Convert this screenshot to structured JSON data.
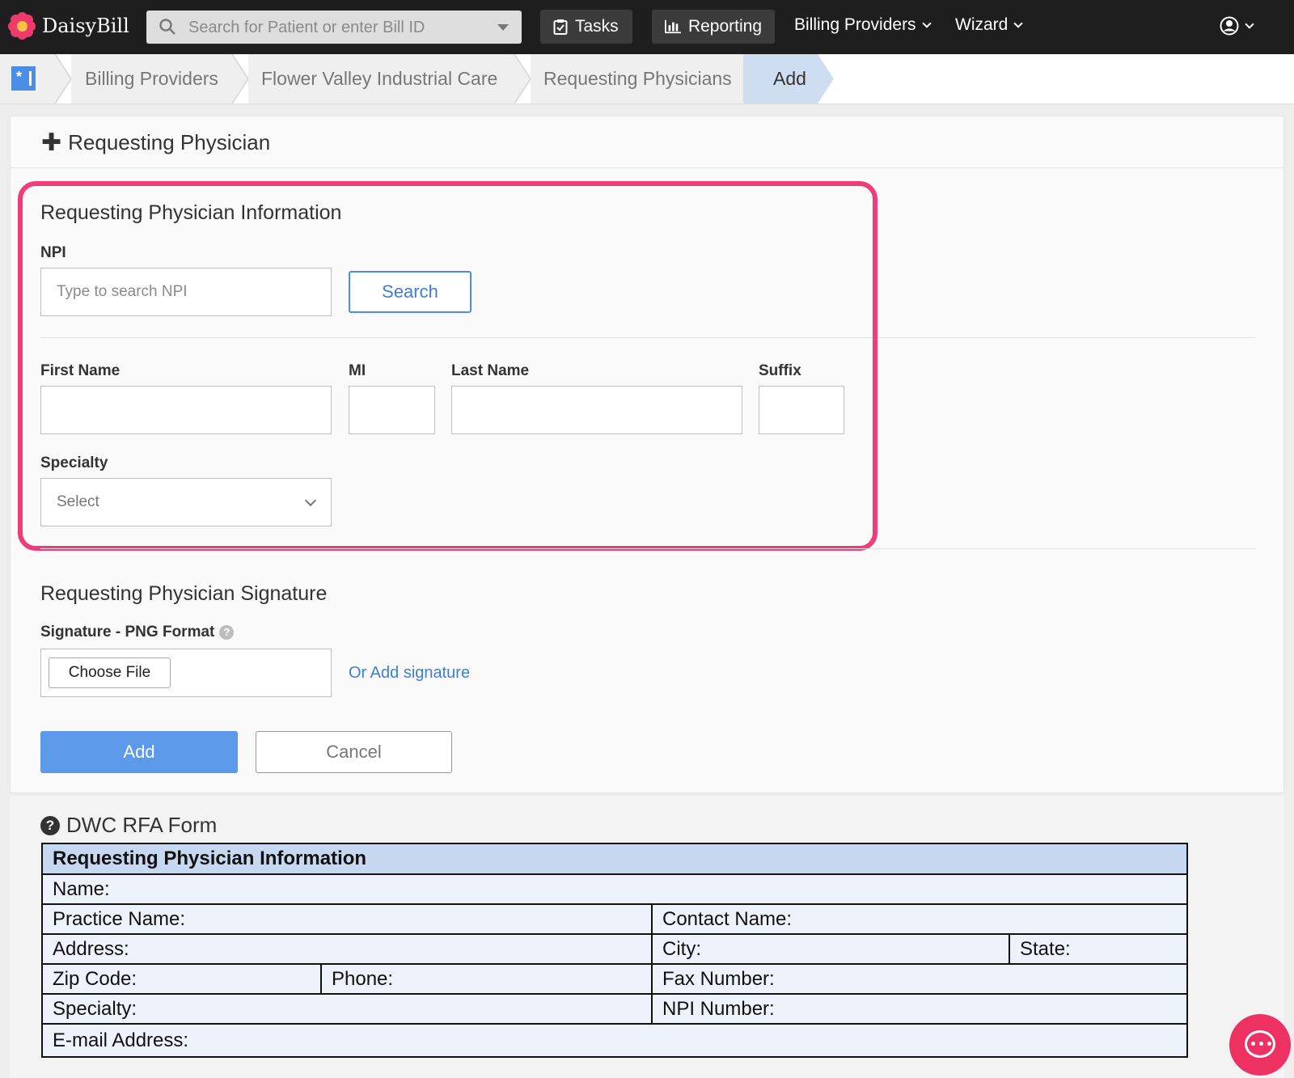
{
  "nav": {
    "brand": "DaisyBill",
    "search_placeholder": "Search for Patient or enter Bill ID",
    "tasks": "Tasks",
    "reporting": "Reporting",
    "billing_providers": "Billing Providers",
    "wizard": "Wizard"
  },
  "breadcrumb": [
    "Billing Providers",
    "Flower Valley Industrial Care",
    "Requesting Physicians",
    "Add"
  ],
  "page": {
    "title": "Requesting Physician",
    "info_section": {
      "heading": "Requesting Physician Information",
      "npi_label": "NPI",
      "npi_placeholder": "Type to search NPI",
      "search_button": "Search",
      "first_name_label": "First Name",
      "mi_label": "MI",
      "last_name_label": "Last Name",
      "suffix_label": "Suffix",
      "specialty_label": "Specialty",
      "specialty_value": "Select"
    },
    "signature_section": {
      "heading": "Requesting Physician Signature",
      "signature_label": "Signature - PNG Format",
      "choose_file": "Choose File",
      "add_signature_link": "Or Add signature"
    },
    "add_button": "Add",
    "cancel_button": "Cancel"
  },
  "dwc_form": {
    "title": "DWC RFA Form",
    "header": "Requesting Physician Information",
    "name": "Name:",
    "practice_name": "Practice Name:",
    "contact_name": "Contact Name:",
    "address": "Address:",
    "city": "City:",
    "state": "State:",
    "zip_code": "Zip Code:",
    "phone": "Phone:",
    "fax_number": "Fax Number:",
    "specialty": "Specialty:",
    "npi_number": "NPI Number:",
    "email": "E-mail Address:"
  },
  "colors": {
    "accent": "#4a8ee6",
    "primary_button": "#5c99e8",
    "highlight": "#f03d7a",
    "nav_bg": "#1e1e1e"
  }
}
